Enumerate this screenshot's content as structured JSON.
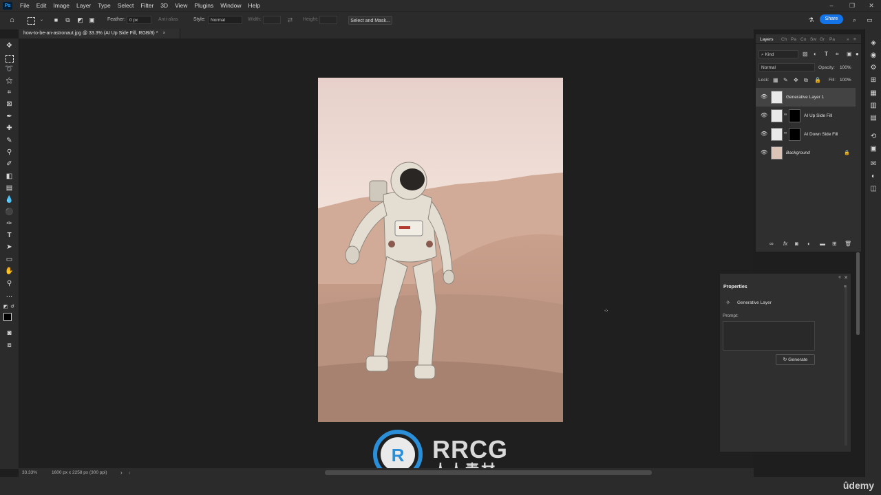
{
  "app": {
    "logo": "Ps",
    "menu": [
      "File",
      "Edit",
      "Image",
      "Layer",
      "Type",
      "Select",
      "Filter",
      "3D",
      "View",
      "Plugins",
      "Window",
      "Help"
    ],
    "window_controls": [
      "–",
      "❐",
      "✕"
    ]
  },
  "options_bar": {
    "feather_label": "Feather:",
    "feather_value": "0 px",
    "anti_alias_label": "Anti-alias",
    "style_label": "Style:",
    "style_value": "Normal",
    "width_label": "Width:",
    "height_label": "Height:",
    "select_mask_label": "Select and Mask...",
    "share_label": "Share"
  },
  "document": {
    "tab_title": "how-to-be-an-astronaut.jpg @ 33.3% (AI Up Side Fill, RGB/8) *",
    "tab_close": "×",
    "zoom": "33.33%",
    "doc_info": "1600 px x 2258 px (300 ppi)",
    "status_arrow": "›"
  },
  "layers_panel": {
    "tabs": [
      "Layers",
      "Ch",
      "Pa",
      "Co",
      "Sw",
      "Gr",
      "Pa"
    ],
    "filter_kind": "Kind",
    "blend_mode": "Normal",
    "opacity_label": "Opacity:",
    "opacity_value": "100%",
    "lock_label": "Lock:",
    "fill_label": "Fill:",
    "fill_value": "100%",
    "layers": [
      {
        "name": "Generative Layer 1",
        "selected": true,
        "has_mask": false,
        "locked": false,
        "italic": false
      },
      {
        "name": "AI Up Side Fill",
        "selected": false,
        "has_mask": true,
        "locked": false,
        "italic": false
      },
      {
        "name": "AI Down Side Fill",
        "selected": false,
        "has_mask": true,
        "locked": false,
        "italic": false
      },
      {
        "name": "Background",
        "selected": false,
        "has_mask": false,
        "locked": true,
        "italic": true
      }
    ]
  },
  "properties_panel": {
    "title": "Properties",
    "layer_type": "Generative Layer",
    "prompt_label": "Prompt:",
    "prompt_value": "",
    "generate_label": "Generate"
  },
  "watermark": {
    "brand": "RRCG",
    "subtitle": "人人素材",
    "source": "ûdemy"
  },
  "colors": {
    "accent": "#1473e6",
    "panel": "#2f2f2f",
    "canvas": "#1f1f1f"
  }
}
